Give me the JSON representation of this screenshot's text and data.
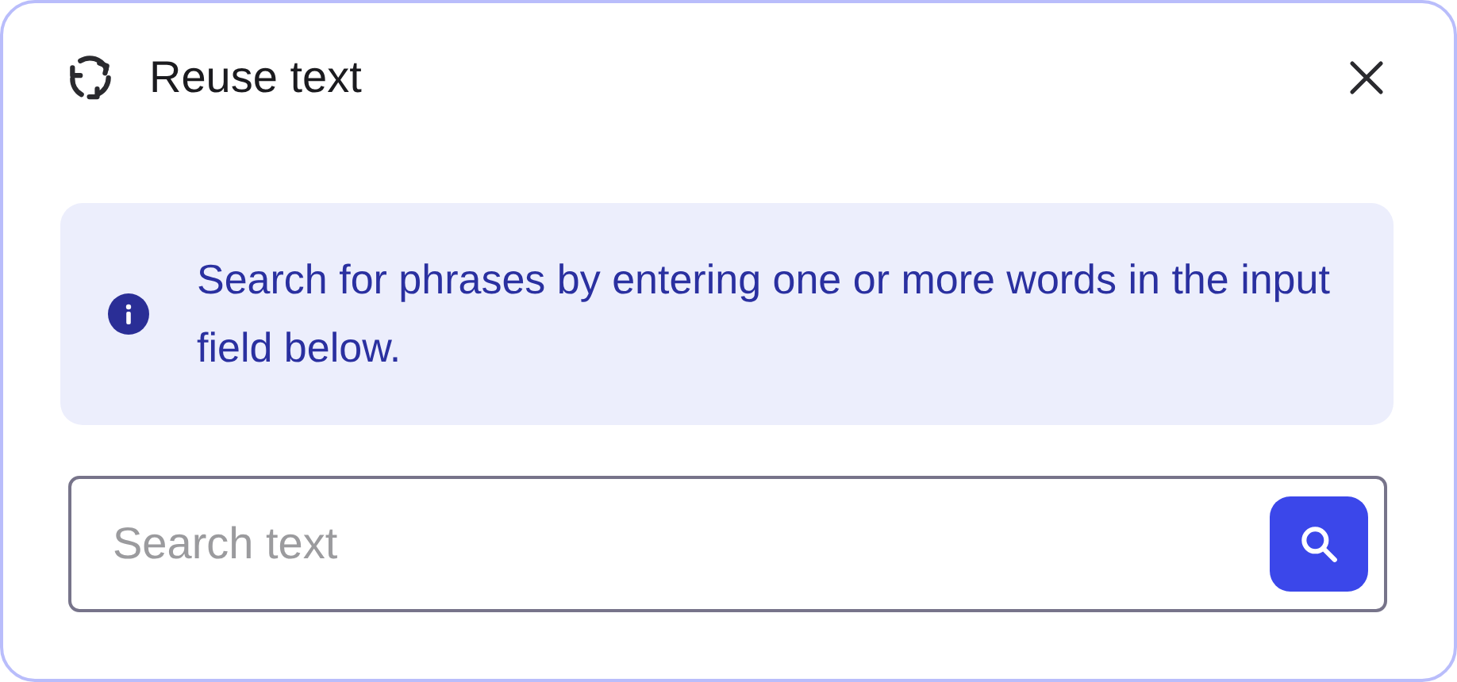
{
  "dialog": {
    "title": "Reuse text"
  },
  "info": {
    "message": "Search for phrases by entering one or more words in the input field below."
  },
  "search": {
    "placeholder": "Search text"
  }
}
